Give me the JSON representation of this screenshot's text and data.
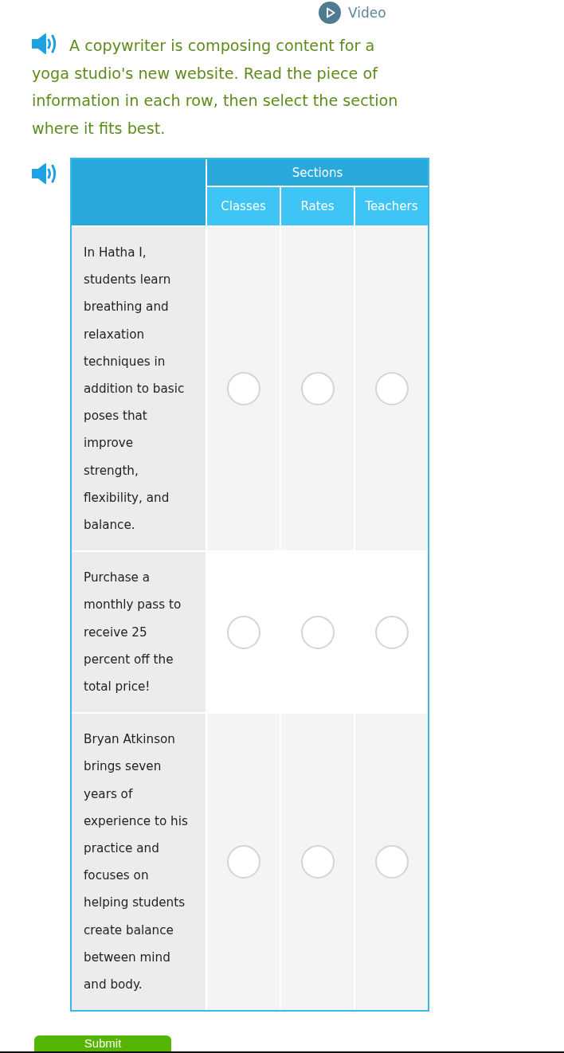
{
  "video_link": {
    "label": "Video"
  },
  "prompt": {
    "text": "A copywriter is composing content for a yoga studio's new website. Read the piece of information in each row, then select the section where it fits best."
  },
  "table": {
    "group_header": "Sections",
    "columns": [
      "Classes",
      "Rates",
      "Teachers"
    ],
    "rows": [
      {
        "text": "In Hatha I, students learn breathing and relaxation techniques in addition to basic poses that improve strength, flexibility, and balance.",
        "options": [
          {
            "selected": false
          },
          {
            "selected": false
          },
          {
            "selected": false
          }
        ]
      },
      {
        "text": "Purchase a monthly pass to receive 25 percent off the total price!",
        "options": [
          {
            "selected": false
          },
          {
            "selected": false
          },
          {
            "selected": false
          }
        ]
      },
      {
        "text": "Bryan Atkinson brings seven years of experience to his practice and focuses on helping students create balance between mind and body.",
        "options": [
          {
            "selected": false
          },
          {
            "selected": false
          },
          {
            "selected": false
          }
        ]
      }
    ]
  },
  "submit_button": {
    "label": "Submit"
  }
}
